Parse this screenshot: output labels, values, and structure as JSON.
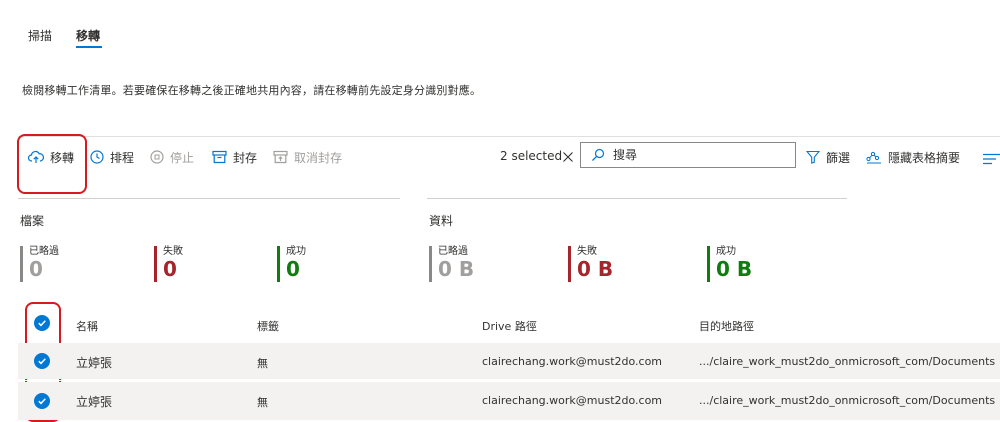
{
  "tabs": [
    {
      "label": "掃描"
    },
    {
      "label": "移轉",
      "active": true
    }
  ],
  "description": "檢閱移轉工作清單。若要確保在移轉之後正確地共用內容，請在移轉前先設定身分識別對應。",
  "toolbar": {
    "migrate_label": "移轉",
    "schedule_label": "排程",
    "stop_label": "停止",
    "archive_label": "封存",
    "unarchive_label": "取消封存",
    "selected_text": "2 selected",
    "search_placeholder": "搜尋",
    "filter_label": "篩選",
    "hide_summary_label": "隱藏表格摘要"
  },
  "files_section": {
    "title": "檔案",
    "stats": [
      {
        "label": "已略過",
        "value": "0",
        "color": "#8a8886"
      },
      {
        "label": "失敗",
        "value": "0",
        "color": "#a4262c"
      },
      {
        "label": "成功",
        "value": "0",
        "color": "#107c10"
      }
    ]
  },
  "data_section": {
    "title": "資料",
    "stats": [
      {
        "label": "已略過",
        "value": "0 B",
        "color": "#8a8886"
      },
      {
        "label": "失敗",
        "value": "0 B",
        "color": "#a4262c"
      },
      {
        "label": "成功",
        "value": "0 B",
        "color": "#107c10"
      }
    ]
  },
  "table": {
    "headers": [
      "名稱",
      "標籤",
      "Drive 路徑",
      "目的地路徑"
    ],
    "rows": [
      {
        "name": "立婷張",
        "tag": "無",
        "drive": "clairechang.work@must2do.com",
        "dest": ".../claire_work_must2do_onmicrosoft_com/Documents",
        "selected": true
      },
      {
        "name": "立婷張",
        "tag": "無",
        "drive": "clairechang.work@must2do.com",
        "dest": ".../claire_work_must2do_onmicrosoft_com/Documents",
        "selected": true
      }
    ]
  },
  "colors": {
    "accent": "#0078d4",
    "highlight": "#d71920"
  }
}
